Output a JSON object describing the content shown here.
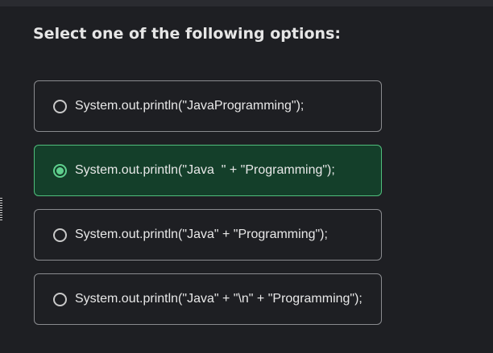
{
  "question": {
    "prompt": "Select one of the following options:"
  },
  "options": [
    {
      "label": "System.out.println(\"JavaProgramming\");",
      "selected": false
    },
    {
      "label": "System.out.println(\"Java  \" + \"Programming\");",
      "selected": true
    },
    {
      "label": "System.out.println(\"Java\" + \"Programming\");",
      "selected": false
    },
    {
      "label": "System.out.println(\"Java\" + \"\\n\" + \"Programming\");",
      "selected": false
    }
  ],
  "colors": {
    "background": "#1e1f23",
    "selected_bg": "#143f2a",
    "selected_border": "#4fbf7c",
    "radio_accent": "#5fd08e"
  }
}
